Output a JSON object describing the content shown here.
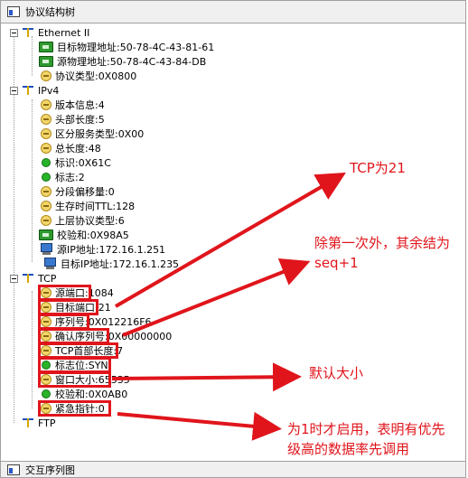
{
  "panes": {
    "top_title": "协议结构树",
    "bottom_title": "交互序列图"
  },
  "tree": {
    "ethernet": {
      "label": "Ethernet II",
      "dst_mac": "目标物理地址:50-78-4C-43-81-61",
      "src_mac": "源物理地址:50-78-4C-43-84-DB",
      "proto_type": "协议类型:0X0800"
    },
    "ipv4": {
      "label": "IPv4",
      "version": "版本信息:4",
      "header_len": "头部长度:5",
      "dsfield": "区分服务类型:0X00",
      "total_len": "总长度:48",
      "ident": "标识:0X61C",
      "flags": "标志:2",
      "frag_offset": "分段偏移量:0",
      "ttl": "生存时间TTL:128",
      "upper_proto": "上层协议类型:6",
      "checksum": "校验和:0X98A5",
      "src_ip": "源IP地址:172.16.1.251",
      "dst_ip": "目标IP地址:172.16.1.235"
    },
    "tcp": {
      "label": "TCP",
      "src_port": "源端口:1084",
      "dst_port": "目标端口:21",
      "seq": "序列号:0X012216F6",
      "ack": "确认序列号:0X00000000",
      "header_len": "TCP首部长度:7",
      "flags": "标志位:SYN",
      "window": "窗口大小:65535",
      "checksum": "校验和:0X0AB0",
      "urgent": "紧急指针:0"
    },
    "ftp": {
      "label": "FTP"
    }
  },
  "annotations": {
    "tcp_port": "TCP为21",
    "seq_note_line1": "除第一次外，其余结为",
    "seq_note_line2": "seq+1",
    "window_note": "默认大小",
    "urgent_note_line1": "为1时才启用，表明有优先",
    "urgent_note_line2": "级高的数据率先调用"
  },
  "colors": {
    "annotation_red": "#e0151b",
    "titlebar_bg": "#f0f0f0"
  }
}
